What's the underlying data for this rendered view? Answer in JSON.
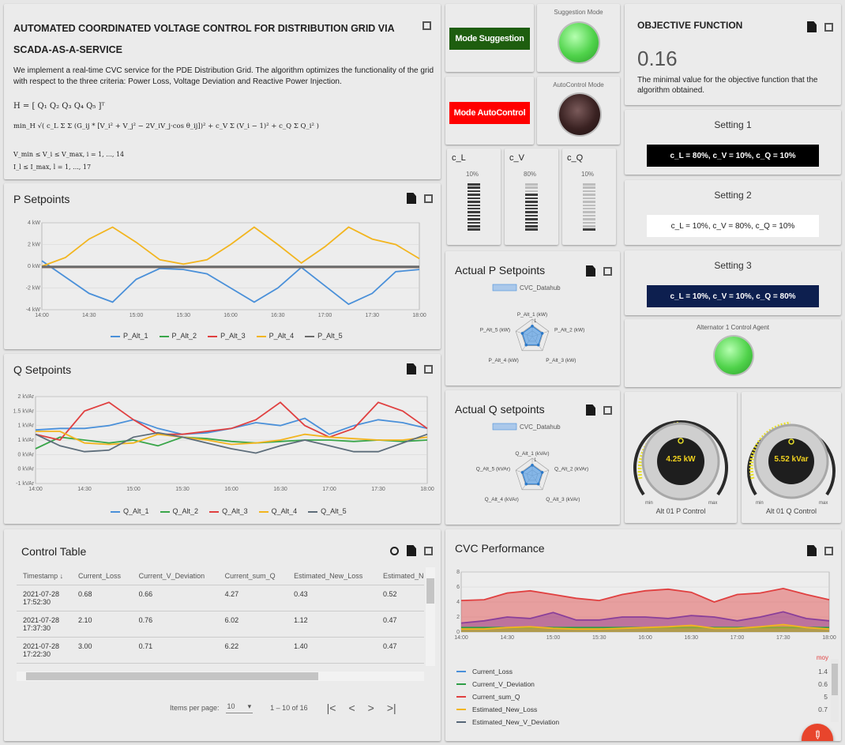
{
  "header": {
    "title": "AUTOMATED COORDINATED VOLTAGE CONTROL FOR DISTRIBUTION GRID VIA SCADA-AS-A-SERVICE",
    "description": "We implement a real-time CVC service for the PDE Distribution Grid. The algorithm optimizes the functionality of the grid with respect to the three criteria: Power Loss, Voltage Deviation and Reactive Power Injection.",
    "formula_1": "H = [ Q₁  Q₂  Q₃  Q₄  Q₅ ]ᵀ",
    "formula_2": "min_H √( c_L Σ Σ (G_ij * [V_i² + V_j² − 2V_iV_j·cos θ_ij])² + c_V Σ (V_i − 1)² + c_Q Σ Q_i² )",
    "formula_3": "V_min ≤ V_i ≤ V_max, i = 1, ..., 14",
    "formula_4": "I_l ≤ I_max, l = 1, ..., 17"
  },
  "mode": {
    "suggestion_label": "Mode Suggestion",
    "autocontrol_label": "Mode AutoControl",
    "suggestion_status_label": "Suggestion Mode",
    "autocontrol_status_label": "AutoControl Mode",
    "suggestion_color": "#2c9e2c",
    "autocontrol_color": "#ff0000"
  },
  "weights": {
    "items": [
      {
        "label": "c_L",
        "value_text": "10%",
        "value": 0.1
      },
      {
        "label": "c_V",
        "value_text": "80%",
        "value": 0.8
      },
      {
        "label": "c_Q",
        "value_text": "10%",
        "value": 0.1
      }
    ]
  },
  "objective": {
    "title": "OBJECTIVE FUNCTION",
    "value": "0.16",
    "caption": "The minimal value for the objective function that the algorithm obtained."
  },
  "settings": [
    {
      "title": "Setting 1",
      "text": "c_L = 80%, c_V = 10%, c_Q = 10%",
      "bg": "#000000",
      "fg": "#ffffff"
    },
    {
      "title": "Setting 2",
      "text": "c_L = 10%, c_V = 80%, c_Q = 10%",
      "bg": "#ffffff",
      "fg": "#222222"
    },
    {
      "title": "Setting 3",
      "text": "c_L = 10%, c_V = 10%, c_Q = 80%",
      "bg": "#0d1f4f",
      "fg": "#ffffff"
    }
  ],
  "agent": {
    "title": "Alternator 1 Control Agent"
  },
  "gauges": {
    "p": {
      "value": "4.25 kW",
      "label": "Alt 01 P Control",
      "min": "min",
      "max": "max"
    },
    "q": {
      "value": "5.52 kVar",
      "label": "Alt 01 Q Control",
      "min": "min",
      "max": "max"
    }
  },
  "p_setpoints": {
    "title": "P Setpoints"
  },
  "q_setpoints": {
    "title": "Q Setpoints"
  },
  "radar_p": {
    "title": "Actual P Setpoints",
    "legend": "CVC_Datahub",
    "scale": "1",
    "labels": [
      "P_Alt_1 (kW)",
      "P_Alt_2 (kW)",
      "P_Alt_3 (kW)",
      "P_Alt_4 (kW)",
      "P_Alt_5 (kW)"
    ]
  },
  "radar_q": {
    "title": "Actual Q setpoints",
    "legend": "CVC_Datahub",
    "scale": "1",
    "labels": [
      "Q_Alt_1 (kVAr)",
      "Q_Alt_2 (kVAr)",
      "Q_Alt_3 (kVAr)",
      "Q_Alt_4 (kVAr)",
      "Q_Alt_5 (kVAr)"
    ]
  },
  "control_table": {
    "title": "Control Table",
    "columns": [
      "Timestamp ↓",
      "Current_Loss",
      "Current_V_Deviation",
      "Current_sum_Q",
      "Estimated_New_Loss",
      "Estimated_New_V_"
    ],
    "rows": [
      [
        "2021-07-28 17:52:30",
        "0.68",
        "0.66",
        "4.27",
        "0.43",
        "0.52"
      ],
      [
        "2021-07-28 17:37:30",
        "2.10",
        "0.76",
        "6.02",
        "1.12",
        "0.47"
      ],
      [
        "2021-07-28 17:22:30",
        "3.00",
        "0.71",
        "6.22",
        "1.40",
        "0.47"
      ]
    ],
    "items_per_page_label": "Items per page:",
    "items_per_page": "10",
    "range": "1 – 10 of 16"
  },
  "performance": {
    "title": "CVC Performance",
    "legend_header": "moy",
    "legend": [
      {
        "name": "Current_Loss",
        "color": "#4a90d9",
        "value": "1.4"
      },
      {
        "name": "Current_V_Deviation",
        "color": "#2e9e47",
        "value": "0.6"
      },
      {
        "name": "Current_sum_Q",
        "color": "#e04040",
        "value": "5"
      },
      {
        "name": "Estimated_New_Loss",
        "color": "#f2b51f",
        "value": "0.7"
      },
      {
        "name": "Estimated_New_V_Deviation",
        "color": "#556677",
        "value": ""
      }
    ]
  },
  "chart_data": [
    {
      "type": "line",
      "x": [
        "14:00",
        "14:30",
        "15:00",
        "15:30",
        "16:00",
        "16:30",
        "17:00",
        "17:30",
        "18:00"
      ],
      "ylim": [
        -4,
        4
      ],
      "y_ticks": [
        "4 kW",
        "2 kW",
        "0 kW",
        "-2 kW",
        "-4 kW"
      ],
      "series": [
        {
          "name": "P_Alt_1",
          "color": "#4a90d9",
          "x": [
            0,
            0.5,
            1,
            1.5,
            2,
            2.5,
            3,
            3.5,
            4,
            4.5,
            5,
            5.5,
            6,
            6.5,
            7,
            7.5,
            8
          ],
          "values": [
            0.5,
            -1,
            -2.5,
            -3.3,
            -1.2,
            -0.2,
            -0.3,
            -0.7,
            -2,
            -3.3,
            -2,
            -0.1,
            -1.8,
            -3.5,
            -2.5,
            -0.5,
            -0.3
          ]
        },
        {
          "name": "P_Alt_2",
          "color": "#3aa64a",
          "x": [
            0,
            8
          ],
          "values": [
            -0.1,
            -0.1
          ]
        },
        {
          "name": "P_Alt_3",
          "color": "#e04040",
          "x": [
            0,
            8
          ],
          "values": [
            -0.1,
            -0.1
          ]
        },
        {
          "name": "P_Alt_4",
          "color": "#f2b51f",
          "x": [
            0,
            0.5,
            1,
            1.5,
            2,
            2.5,
            3,
            3.5,
            4,
            4.5,
            5,
            5.5,
            6,
            6.5,
            7,
            7.5,
            8
          ],
          "values": [
            0,
            0.8,
            2.5,
            3.6,
            2.2,
            0.6,
            0.2,
            0.6,
            2,
            3.6,
            2,
            0.3,
            1.8,
            3.6,
            2.5,
            2,
            0.7
          ]
        },
        {
          "name": "P_Alt_5",
          "color": "#6a6a6a",
          "x": [
            0,
            8
          ],
          "values": [
            -0.05,
            -0.05
          ]
        }
      ]
    },
    {
      "type": "line",
      "x": [
        "14:00",
        "14:30",
        "15:00",
        "15:30",
        "16:00",
        "16:30",
        "17:00",
        "17:30",
        "18:00"
      ],
      "ylim": [
        -1,
        2
      ],
      "y_ticks": [
        "2 kVAr",
        "1.5 kVAr",
        "1 kVAr",
        "1 kVAr",
        "0 kVAr",
        "0 kVAr",
        "-1 kVAr"
      ],
      "series": [
        {
          "name": "Q_Alt_1",
          "color": "#4a90d9",
          "x": [
            0,
            0.5,
            1,
            1.5,
            2,
            2.5,
            3,
            3.5,
            4,
            4.5,
            5,
            5.5,
            6,
            6.5,
            7,
            7.5,
            8
          ],
          "values": [
            0.85,
            0.9,
            0.9,
            1.0,
            1.2,
            0.9,
            0.7,
            0.75,
            0.9,
            1.1,
            1.0,
            1.25,
            0.7,
            1.0,
            1.2,
            1.1,
            0.9
          ]
        },
        {
          "name": "Q_Alt_2",
          "color": "#3aa64a",
          "x": [
            0,
            0.5,
            1,
            1.5,
            2,
            2.5,
            3,
            3.5,
            4,
            4.5,
            5,
            5.5,
            6,
            6.5,
            7,
            7.5,
            8
          ],
          "values": [
            0.2,
            0.6,
            0.5,
            0.4,
            0.5,
            0.3,
            0.6,
            0.55,
            0.45,
            0.4,
            0.45,
            0.5,
            0.5,
            0.45,
            0.5,
            0.45,
            0.5
          ]
        },
        {
          "name": "Q_Alt_3",
          "color": "#e04040",
          "x": [
            0,
            0.5,
            1,
            1.5,
            2,
            2.5,
            3,
            3.5,
            4,
            4.5,
            5,
            5.5,
            6,
            6.5,
            7,
            7.5,
            8
          ],
          "values": [
            0.7,
            0.5,
            1.5,
            1.8,
            1.2,
            0.7,
            0.7,
            0.8,
            0.9,
            1.2,
            1.8,
            1.0,
            0.6,
            0.9,
            1.8,
            1.5,
            0.9
          ]
        },
        {
          "name": "Q_Alt_4",
          "color": "#f2b51f",
          "x": [
            0,
            0.5,
            1,
            1.5,
            2,
            2.5,
            3,
            3.5,
            4,
            4.5,
            5,
            5.5,
            6,
            6.5,
            7,
            7.5,
            8
          ],
          "values": [
            0.8,
            0.8,
            0.4,
            0.35,
            0.4,
            0.7,
            0.6,
            0.5,
            0.35,
            0.4,
            0.5,
            0.7,
            0.6,
            0.55,
            0.5,
            0.5,
            0.6
          ]
        },
        {
          "name": "Q_Alt_5",
          "color": "#5d6d7a",
          "x": [
            0,
            0.5,
            1,
            1.5,
            2,
            2.5,
            3,
            3.5,
            4,
            4.5,
            5,
            5.5,
            6,
            6.5,
            7,
            7.5,
            8
          ],
          "values": [
            0.7,
            0.3,
            0.1,
            0.15,
            0.6,
            0.75,
            0.6,
            0.4,
            0.2,
            0.05,
            0.3,
            0.5,
            0.3,
            0.1,
            0.1,
            0.4,
            0.7
          ]
        }
      ]
    },
    {
      "type": "area",
      "x": [
        "14:00",
        "14:30",
        "15:00",
        "15:30",
        "16:00",
        "16:30",
        "17:00",
        "17:30",
        "18:00"
      ],
      "ylim": [
        0,
        8
      ],
      "y_ticks": [
        "8",
        "6",
        "4",
        "2",
        "0"
      ],
      "series": [
        {
          "name": "Current_sum_Q",
          "color": "#e04040",
          "x": [
            0,
            0.5,
            1,
            1.5,
            2,
            2.5,
            3,
            3.5,
            4,
            4.5,
            5,
            5.5,
            6,
            6.5,
            7,
            7.5,
            8
          ],
          "values": [
            4.2,
            4.3,
            5.2,
            5.5,
            5.0,
            4.5,
            4.2,
            5.0,
            5.5,
            5.7,
            5.3,
            4.0,
            5.0,
            5.2,
            5.8,
            5.0,
            4.3
          ]
        },
        {
          "name": "Current_Loss",
          "color": "#8a3f9a",
          "x": [
            0,
            0.5,
            1,
            1.5,
            2,
            2.5,
            3,
            3.5,
            4,
            4.5,
            5,
            5.5,
            6,
            6.5,
            7,
            7.5,
            8
          ],
          "values": [
            1.2,
            1.5,
            2.0,
            1.8,
            2.6,
            1.6,
            1.6,
            2.0,
            2.0,
            1.8,
            2.2,
            2.0,
            1.5,
            2.0,
            2.7,
            1.8,
            1.5
          ]
        },
        {
          "name": "Current_V_Deviation",
          "color": "#2e9e47",
          "x": [
            0,
            8
          ],
          "values": [
            0.6,
            0.6
          ]
        },
        {
          "name": "Estimated_New_Loss",
          "color": "#f2b51f",
          "x": [
            0,
            0.5,
            1,
            1.5,
            2,
            2.5,
            3,
            3.5,
            4,
            4.5,
            5,
            5.5,
            6,
            6.5,
            7,
            7.5,
            8
          ],
          "values": [
            0.4,
            0.4,
            0.6,
            0.7,
            0.5,
            0.4,
            0.4,
            0.5,
            0.6,
            0.7,
            0.9,
            0.5,
            0.5,
            0.7,
            1.0,
            0.6,
            0.4
          ]
        }
      ]
    }
  ]
}
